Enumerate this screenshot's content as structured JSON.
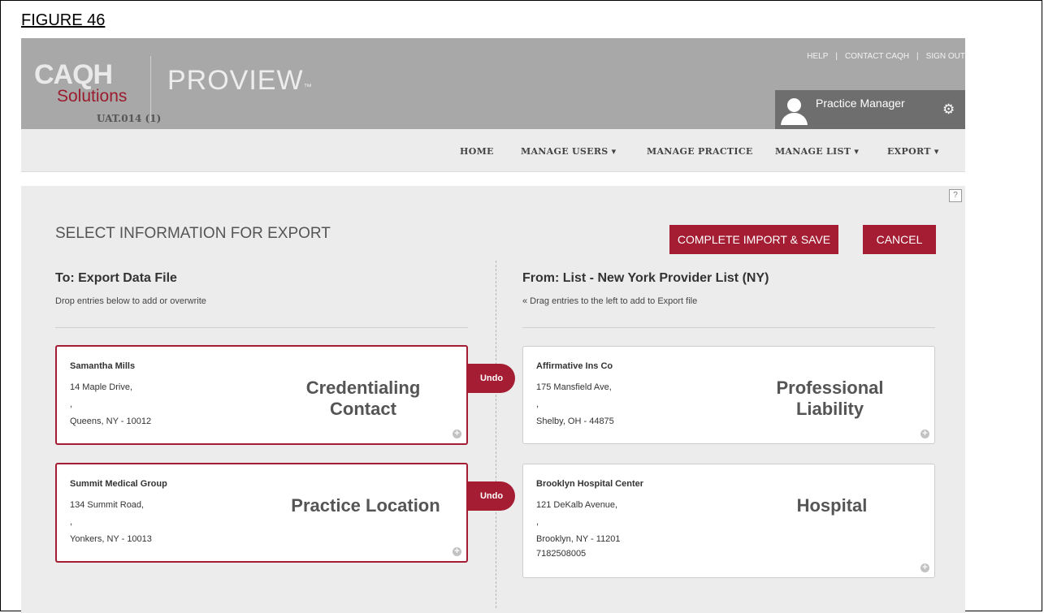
{
  "figure_label": "FIGURE 46",
  "header": {
    "logo_main": "CAQH",
    "logo_sub": "Solutions",
    "version": "UAT.014 (1)",
    "product": "PROVIEW",
    "product_tm": "™",
    "links": [
      "HELP",
      "CONTACT CAQH",
      "SIGN OUT"
    ],
    "user_name": "Practice Manager"
  },
  "nav": {
    "items": [
      {
        "label": "HOME",
        "dropdown": false
      },
      {
        "label": "MANAGE USERS ▾",
        "dropdown": true
      },
      {
        "label": "MANAGE PRACTICE",
        "dropdown": false
      },
      {
        "label": "MANAGE LIST ▾",
        "dropdown": true
      },
      {
        "label": "EXPORT ▾",
        "dropdown": true
      }
    ]
  },
  "main": {
    "help_icon_glyph": "?",
    "section_title": "SELECT INFORMATION FOR EXPORT",
    "complete_label": "COMPLETE IMPORT & SAVE",
    "cancel_label": "CANCEL",
    "left_column": {
      "title": "To: Export Data File",
      "subtitle": "Drop entries below to add or overwrite"
    },
    "right_column": {
      "title": "From: List - New York Provider List (NY)",
      "subtitle": "« Drag entries to the left to add to Export file"
    },
    "undo_label": "Undo",
    "left_cards": [
      {
        "name": "Samantha Mills",
        "line1": "14 Maple Drive,",
        "line2": ",",
        "line3": "Queens, NY - 10012",
        "kind": "Credentialing Contact"
      },
      {
        "name": "Summit Medical Group",
        "line1": "134 Summit Road,",
        "line2": ",",
        "line3": "Yonkers, NY - 10013",
        "kind": "Practice Location"
      }
    ],
    "right_cards": [
      {
        "name": "Affirmative Ins Co",
        "line1": "175 Mansfield Ave,",
        "line2": ",",
        "line3": "Shelby, OH - 44875",
        "kind": "Professional Liability"
      },
      {
        "name": "Brooklyn Hospital Center",
        "line1": "121 DeKalb Avenue,",
        "line2": ",",
        "line3": "Brooklyn, NY - 11201",
        "line4": "7182508005",
        "kind": "Hospital"
      }
    ]
  },
  "colors": {
    "accent": "#a41d33",
    "header_bg": "#a8a8a8",
    "content_bg": "#ececec"
  }
}
